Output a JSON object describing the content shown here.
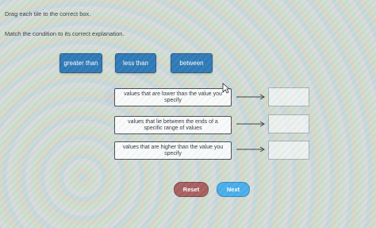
{
  "instructions": {
    "line1": "Drag each tile to the correct box.",
    "line2": "Match the condition to its correct explanation."
  },
  "tiles": [
    {
      "label": "greater than"
    },
    {
      "label": "less than"
    },
    {
      "label": "between"
    }
  ],
  "conditions": [
    {
      "text": "values that are lower than the value you specify"
    },
    {
      "text": "values that lie between the ends of a specific range of values"
    },
    {
      "text": "values that are higher than the value you specify"
    }
  ],
  "buttons": {
    "reset": "Reset",
    "next": "Next"
  },
  "colors": {
    "tile": "#1e6fb0",
    "reset": "#a25252",
    "next": "#3aa8e8"
  }
}
